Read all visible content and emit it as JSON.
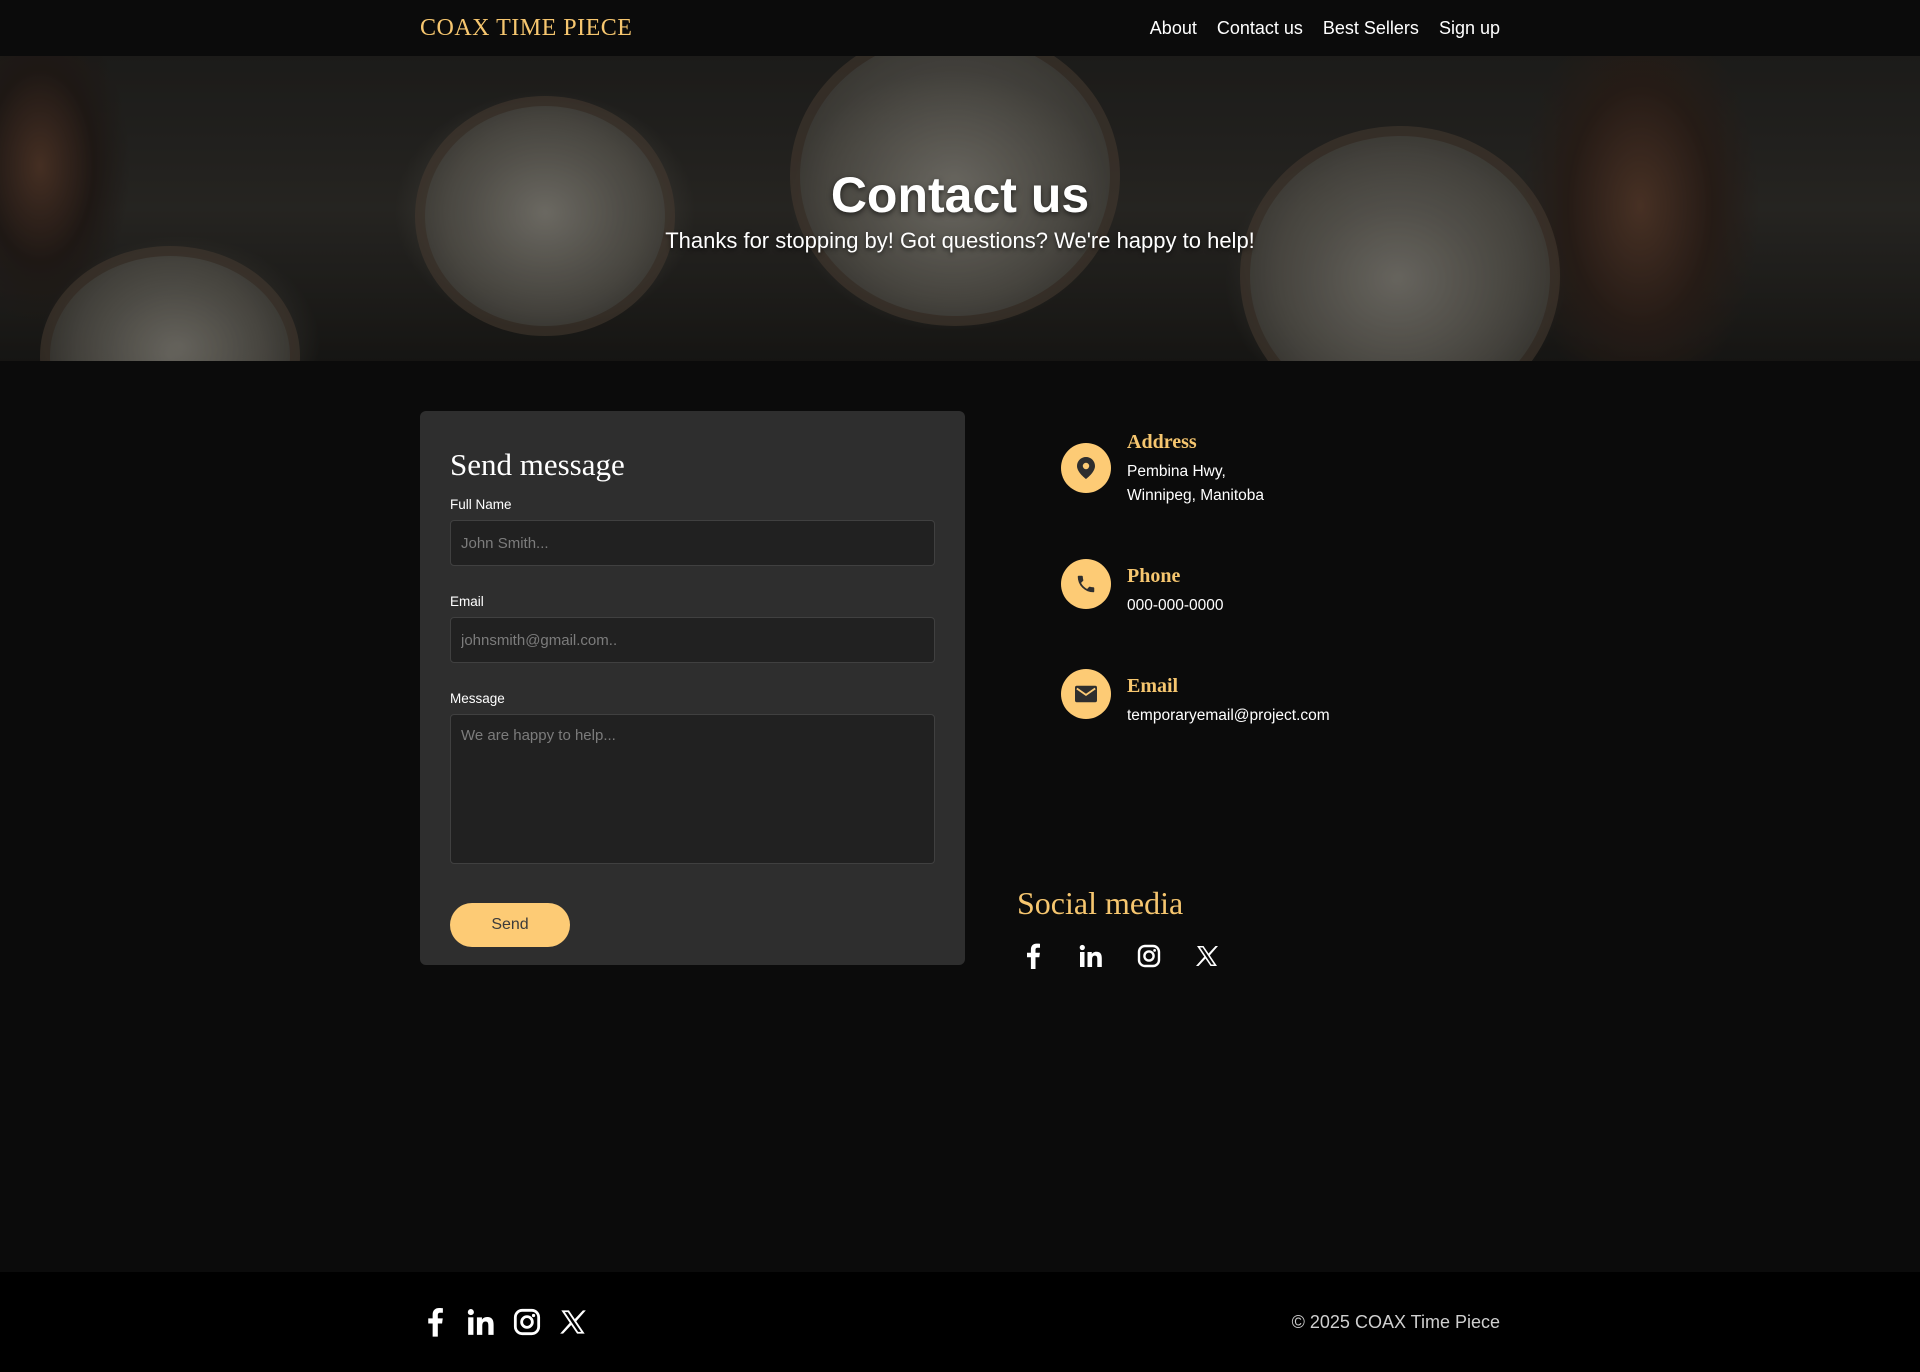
{
  "navbar": {
    "brand": "COAX TIME PIECE",
    "links": [
      "About",
      "Contact us",
      "Best Sellers",
      "Sign up"
    ]
  },
  "hero": {
    "title": "Contact us",
    "subtitle": "Thanks for stopping by! Got questions? We're happy to help!"
  },
  "form": {
    "title": "Send message",
    "full_name_label": "Full Name",
    "full_name_placeholder": "John Smith...",
    "email_label": "Email",
    "email_placeholder": "johnsmith@gmail.com..",
    "message_label": "Message",
    "message_placeholder": "We are happy to help...",
    "send_label": "Send"
  },
  "contact": {
    "address_title": "Address",
    "address_line1": "Pembina Hwy,",
    "address_line2": "Winnipeg, Manitoba",
    "phone_title": "Phone",
    "phone_value": "000-000-0000",
    "email_title": "Email",
    "email_value": "temporaryemail@project.com"
  },
  "social": {
    "title": "Social media",
    "icons": [
      "facebook-icon",
      "linkedin-icon",
      "instagram-icon",
      "x-icon"
    ]
  },
  "footer": {
    "copyright": "© 2025 COAX Time Piece"
  },
  "colors": {
    "accent": "#fdcb75",
    "accent_text": "#f6c66f",
    "background": "#0b0b0b",
    "card": "#2e2e2e",
    "input": "#212121",
    "footer": "#000000"
  }
}
